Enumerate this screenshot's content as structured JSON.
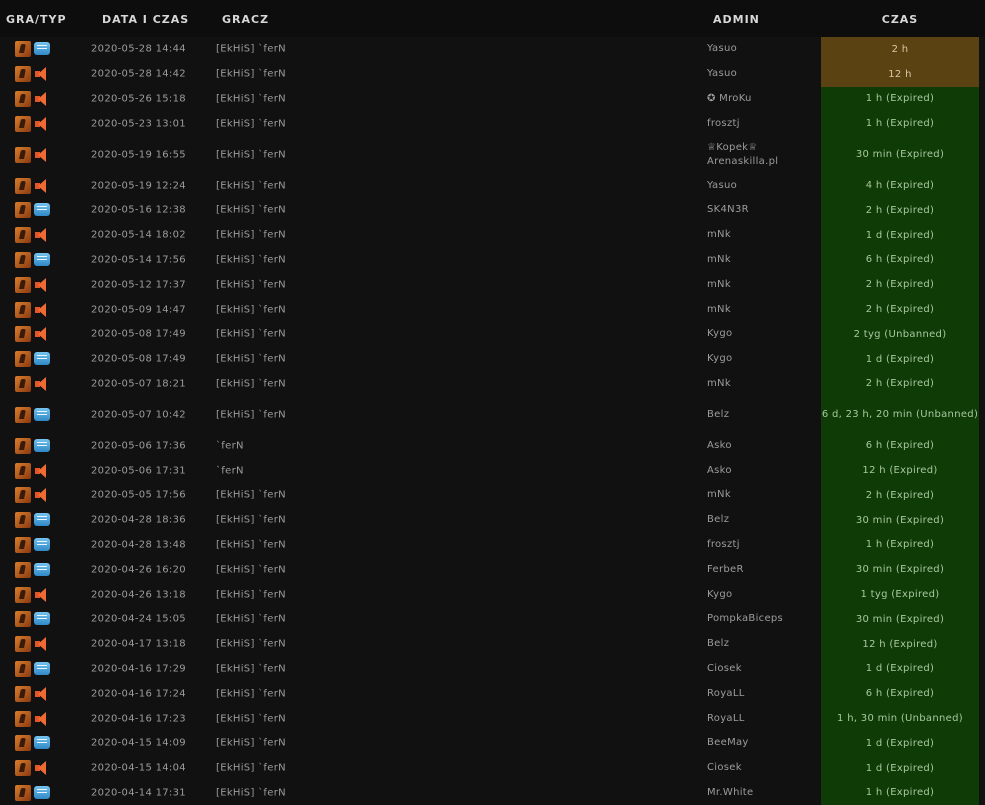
{
  "header": {
    "gra_typ": "GRA/TYP",
    "date": "DATA I CZAS",
    "player": "GRACZ",
    "admin": "ADMIN",
    "time": "CZAS"
  },
  "colors": {
    "active": "#5b4212",
    "expired": "#0e3b06"
  },
  "rows": [
    {
      "type": "chat-icon",
      "date": "2020-05-28 14:44",
      "player": "[EkHiS] `ferN",
      "admin": "Yasuo",
      "time": "2 h",
      "status": "active"
    },
    {
      "type": "speaker-icon",
      "date": "2020-05-28 14:42",
      "player": "[EkHiS] `ferN",
      "admin": "Yasuo",
      "time": "12 h",
      "status": "active"
    },
    {
      "type": "speaker-icon",
      "date": "2020-05-26 15:18",
      "player": "[EkHiS] `ferN",
      "admin": "✪ MroKu",
      "time": "1 h (Expired)",
      "status": "expired"
    },
    {
      "type": "speaker-icon",
      "date": "2020-05-23 13:01",
      "player": "[EkHiS] `ferN",
      "admin": "frosztj",
      "time": "1 h (Expired)",
      "status": "expired"
    },
    {
      "type": "speaker-icon",
      "date": "2020-05-19 16:55",
      "player": "[EkHiS] `ferN",
      "admin": "♕Kopek♕ Arenaskilla.pl",
      "time": "30 min (Expired)",
      "status": "expired",
      "tall": true
    },
    {
      "type": "speaker-icon",
      "date": "2020-05-19 12:24",
      "player": "[EkHiS] `ferN",
      "admin": "Yasuo",
      "time": "4 h (Expired)",
      "status": "expired"
    },
    {
      "type": "chat-icon",
      "date": "2020-05-16 12:38",
      "player": "[EkHiS] `ferN",
      "admin": "SK4N3R",
      "time": "2 h (Expired)",
      "status": "expired"
    },
    {
      "type": "speaker-icon",
      "date": "2020-05-14 18:02",
      "player": "[EkHiS] `ferN",
      "admin": "mNk",
      "time": "1 d (Expired)",
      "status": "expired"
    },
    {
      "type": "chat-icon",
      "date": "2020-05-14 17:56",
      "player": "[EkHiS] `ferN",
      "admin": "mNk",
      "time": "6 h (Expired)",
      "status": "expired"
    },
    {
      "type": "speaker-icon",
      "date": "2020-05-12 17:37",
      "player": "[EkHiS] `ferN",
      "admin": "mNk",
      "time": "2 h (Expired)",
      "status": "expired"
    },
    {
      "type": "speaker-icon",
      "date": "2020-05-09 14:47",
      "player": "[EkHiS] `ferN",
      "admin": "mNk",
      "time": "2 h (Expired)",
      "status": "expired"
    },
    {
      "type": "speaker-icon",
      "date": "2020-05-08 17:49",
      "player": "[EkHiS] `ferN",
      "admin": "Kygo",
      "time": "2 tyg (Unbanned)",
      "status": "expired"
    },
    {
      "type": "chat-icon",
      "date": "2020-05-08 17:49",
      "player": "[EkHiS] `ferN",
      "admin": "Kygo",
      "time": "1 d (Expired)",
      "status": "expired"
    },
    {
      "type": "speaker-icon",
      "date": "2020-05-07 18:21",
      "player": "[EkHiS] `ferN",
      "admin": "mNk",
      "time": "2 h (Expired)",
      "status": "expired"
    },
    {
      "type": "chat-icon",
      "date": "2020-05-07 10:42",
      "player": "[EkHiS] `ferN",
      "admin": "Belz",
      "time": "6 d, 23 h, 20 min (Unbanned)",
      "status": "expired",
      "tall": true
    },
    {
      "type": "chat-icon",
      "date": "2020-05-06 17:36",
      "player": "`ferN",
      "admin": "Asko",
      "time": "6 h (Expired)",
      "status": "expired"
    },
    {
      "type": "speaker-icon",
      "date": "2020-05-06 17:31",
      "player": "`ferN",
      "admin": "Asko",
      "time": "12 h (Expired)",
      "status": "expired"
    },
    {
      "type": "speaker-icon",
      "date": "2020-05-05 17:56",
      "player": "[EkHiS] `ferN",
      "admin": "mNk",
      "time": "2 h (Expired)",
      "status": "expired"
    },
    {
      "type": "chat-icon",
      "date": "2020-04-28 18:36",
      "player": "[EkHiS] `ferN",
      "admin": "Belz",
      "time": "30 min (Expired)",
      "status": "expired"
    },
    {
      "type": "chat-icon",
      "date": "2020-04-28 13:48",
      "player": "[EkHiS] `ferN",
      "admin": "frosztj",
      "time": "1 h (Expired)",
      "status": "expired"
    },
    {
      "type": "chat-icon",
      "date": "2020-04-26 16:20",
      "player": "[EkHiS] `ferN",
      "admin": "FerbeR",
      "time": "30 min (Expired)",
      "status": "expired"
    },
    {
      "type": "speaker-icon",
      "date": "2020-04-26 13:18",
      "player": "[EkHiS] `ferN",
      "admin": "Kygo",
      "time": "1 tyg (Expired)",
      "status": "expired"
    },
    {
      "type": "chat-icon",
      "date": "2020-04-24 15:05",
      "player": "[EkHiS] `ferN",
      "admin": "PompkaBiceps",
      "time": "30 min (Expired)",
      "status": "expired"
    },
    {
      "type": "speaker-icon",
      "date": "2020-04-17 13:18",
      "player": "[EkHiS] `ferN",
      "admin": "Belz",
      "time": "12 h (Expired)",
      "status": "expired"
    },
    {
      "type": "chat-icon",
      "date": "2020-04-16 17:29",
      "player": "[EkHiS] `ferN",
      "admin": "Ciosek",
      "time": "1 d (Expired)",
      "status": "expired"
    },
    {
      "type": "speaker-icon",
      "date": "2020-04-16 17:24",
      "player": "[EkHiS] `ferN",
      "admin": "RoyaLL",
      "time": "6 h (Expired)",
      "status": "expired"
    },
    {
      "type": "speaker-icon",
      "date": "2020-04-16 17:23",
      "player": "[EkHiS] `ferN",
      "admin": "RoyaLL",
      "time": "1 h, 30 min (Unbanned)",
      "status": "expired"
    },
    {
      "type": "chat-icon",
      "date": "2020-04-15 14:09",
      "player": "[EkHiS] `ferN",
      "admin": "BeeMay",
      "time": "1 d (Expired)",
      "status": "expired"
    },
    {
      "type": "speaker-icon",
      "date": "2020-04-15 14:04",
      "player": "[EkHiS] `ferN",
      "admin": "Ciosek",
      "time": "1 d (Expired)",
      "status": "expired"
    },
    {
      "type": "chat-icon",
      "date": "2020-04-14 17:31",
      "player": "[EkHiS] `ferN",
      "admin": "Mr.White",
      "time": "1 h (Expired)",
      "status": "expired"
    }
  ]
}
